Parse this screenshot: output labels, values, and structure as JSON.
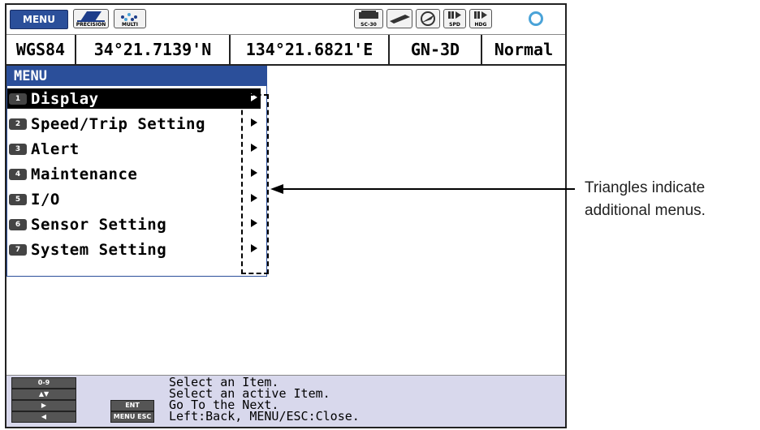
{
  "topbar": {
    "menu_label": "MENU",
    "icons": [
      {
        "name": "precision-icon",
        "caption": "PRECISION"
      },
      {
        "name": "multi-icon",
        "caption": "MULTI"
      },
      {
        "name": "sc30-icon",
        "caption": "SC-30"
      },
      {
        "name": "ship-icon",
        "caption": ""
      },
      {
        "name": "compass-icon",
        "caption": ""
      },
      {
        "name": "spd-icon",
        "caption": "SPD"
      },
      {
        "name": "hdg-icon",
        "caption": "HDG"
      }
    ],
    "status_icon": "gear-icon"
  },
  "position": {
    "datum": "WGS84",
    "latitude": "34°21.7139'N",
    "longitude": "134°21.6821'E",
    "fix_mode": "GN-3D",
    "status": "Normal"
  },
  "menu": {
    "title": "MENU",
    "selected_index": 0,
    "items": [
      {
        "num": "1",
        "label": "Display"
      },
      {
        "num": "2",
        "label": "Speed/Trip Setting"
      },
      {
        "num": "3",
        "label": "Alert"
      },
      {
        "num": "4",
        "label": "Maintenance"
      },
      {
        "num": "5",
        "label": "I/O"
      },
      {
        "num": "6",
        "label": "Sensor Setting"
      },
      {
        "num": "7",
        "label": "System Setting"
      }
    ]
  },
  "help": {
    "keys_left": [
      "0-9",
      "▲▼",
      "▶",
      "◀"
    ],
    "keys_mid": [
      "ENT",
      "MENU ESC"
    ],
    "lines": [
      "Select an Item.",
      "Select an active Item.",
      "Go To the Next.",
      "Left:Back, MENU/ESC:Close."
    ]
  },
  "callout": {
    "text": "Triangles indicate additional menus."
  },
  "colors": {
    "accent": "#2b4f9a",
    "help_background": "#d8d8ec",
    "selection": "#000000"
  }
}
